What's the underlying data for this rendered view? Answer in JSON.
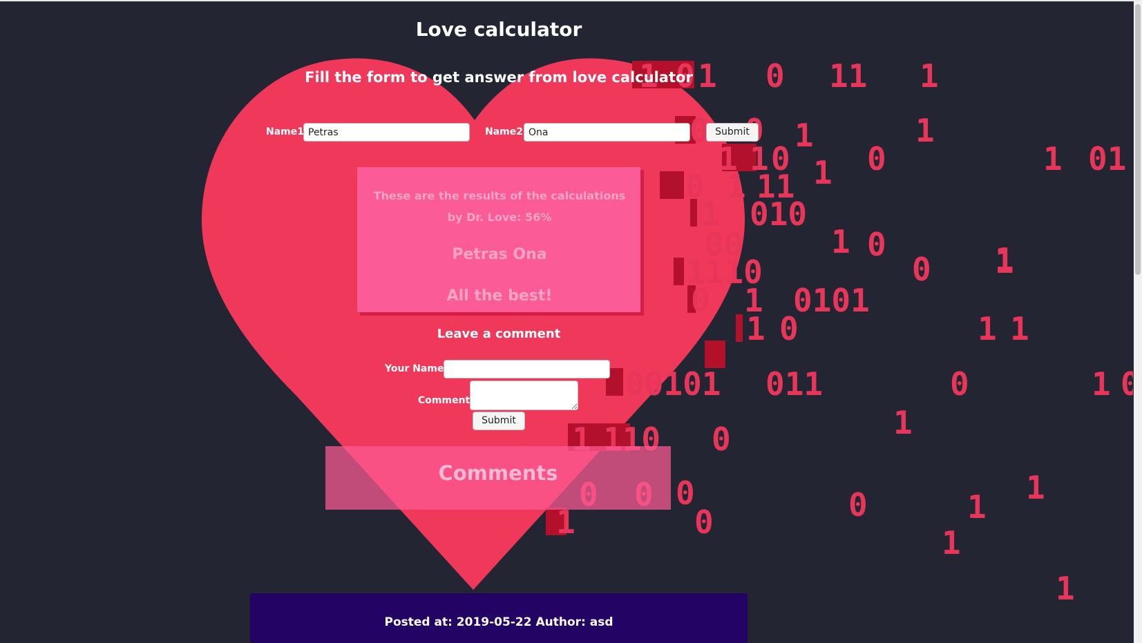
{
  "page": {
    "title": "Love calculator",
    "subtitle": "Fill the form to get answer from love calculator"
  },
  "colors": {
    "background": "#242533",
    "heart": "#ef385a",
    "digits": "#e8365a",
    "result_box": "#fb5b97",
    "footer": "#230364"
  },
  "form": {
    "name1_label": "Name1:",
    "name1_value": "Petras",
    "name2_label": "Name2:",
    "name2_value": "Ona",
    "submit_label": "Submit"
  },
  "result": {
    "line1": "These are the results of the calculations",
    "line2": "by Dr. Love: 56%",
    "names": "Petras Ona",
    "wish": "All the best!"
  },
  "comment_form": {
    "heading": "Leave a comment",
    "name_label": "Your Name:",
    "name_value": "",
    "comment_label": "Comment:",
    "comment_value": "",
    "submit_label": "Submit"
  },
  "comments": {
    "title": "Comments"
  },
  "footer": {
    "text": "Posted at: 2019-05-22 Author: asd"
  },
  "binary_rain": [
    "1",
    "0",
    "1",
    "0",
    "11",
    "1",
    "0",
    "0",
    "1",
    "1",
    "1",
    "1",
    "0",
    "1",
    "0",
    "1",
    "01",
    "0",
    "1",
    "11",
    "1",
    "010",
    "00",
    "1",
    "0",
    "1",
    "1110",
    "0",
    "1",
    "0",
    "1",
    "0101",
    "1",
    "0",
    "1",
    "1",
    "00101",
    "011",
    "0",
    "1",
    "0",
    "1",
    "1",
    "110",
    "0",
    "0",
    "0",
    "0",
    "1",
    "0",
    "1",
    "1",
    "0",
    "1",
    "1"
  ]
}
